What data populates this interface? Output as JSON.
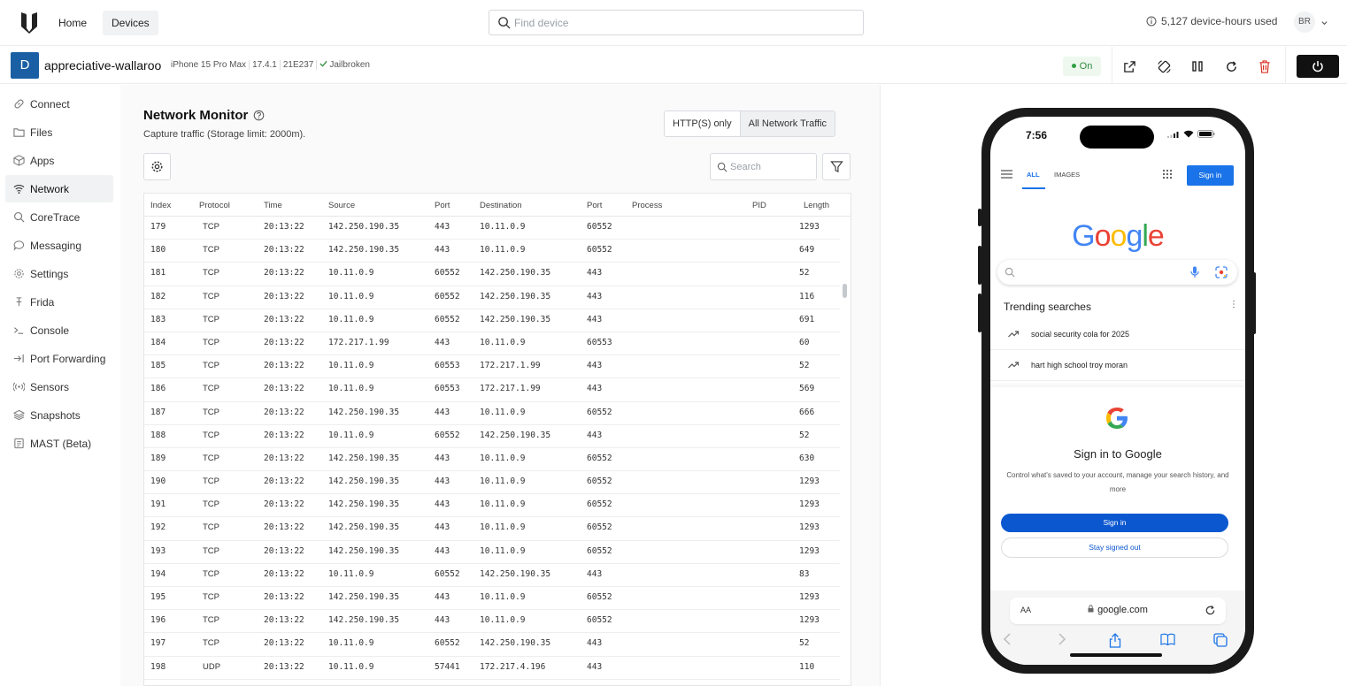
{
  "topbar": {
    "nav": [
      {
        "label": "Home"
      },
      {
        "label": "Devices"
      }
    ],
    "search_placeholder": "Find device",
    "hours_used": "5,127 device-hours used",
    "user_initials": "BR"
  },
  "device": {
    "avatar": "D",
    "name": "appreciative-wallaroo",
    "model": "iPhone 15 Pro Max",
    "os_version": "17.4.1",
    "build": "21E237",
    "jailbreak": "Jailbroken",
    "status": "On"
  },
  "sidebar": {
    "items": [
      {
        "label": "Connect",
        "icon": "link-icon"
      },
      {
        "label": "Files",
        "icon": "folder-icon"
      },
      {
        "label": "Apps",
        "icon": "cube-icon"
      },
      {
        "label": "Network",
        "icon": "wifi-icon"
      },
      {
        "label": "CoreTrace",
        "icon": "search-icon"
      },
      {
        "label": "Messaging",
        "icon": "chat-icon"
      },
      {
        "label": "Settings",
        "icon": "gear-icon"
      },
      {
        "label": "Frida",
        "icon": "frida-icon"
      },
      {
        "label": "Console",
        "icon": "terminal-icon"
      },
      {
        "label": "Port Forwarding",
        "icon": "port-forward-icon"
      },
      {
        "label": "Sensors",
        "icon": "sensors-icon"
      },
      {
        "label": "Snapshots",
        "icon": "layers-icon"
      },
      {
        "label": "MAST (Beta)",
        "icon": "report-icon"
      }
    ],
    "active": "Network"
  },
  "network": {
    "title": "Network Monitor",
    "subtitle": "Capture traffic (Storage limit: 2000m).",
    "mode_http": "HTTP(S) only",
    "mode_all": "All Network Traffic",
    "search_placeholder": "Search",
    "columns": [
      "Index",
      "Protocol",
      "Time",
      "Source",
      "Port",
      "Destination",
      "Port",
      "Process",
      "PID",
      "Length"
    ],
    "rows": [
      [
        "179",
        "TCP",
        "20:13:22",
        "142.250.190.35",
        "443",
        "10.11.0.9",
        "60552",
        "",
        "",
        "1293"
      ],
      [
        "180",
        "TCP",
        "20:13:22",
        "142.250.190.35",
        "443",
        "10.11.0.9",
        "60552",
        "",
        "",
        "649"
      ],
      [
        "181",
        "TCP",
        "20:13:22",
        "10.11.0.9",
        "60552",
        "142.250.190.35",
        "443",
        "",
        "",
        "52"
      ],
      [
        "182",
        "TCP",
        "20:13:22",
        "10.11.0.9",
        "60552",
        "142.250.190.35",
        "443",
        "",
        "",
        "116"
      ],
      [
        "183",
        "TCP",
        "20:13:22",
        "10.11.0.9",
        "60552",
        "142.250.190.35",
        "443",
        "",
        "",
        "691"
      ],
      [
        "184",
        "TCP",
        "20:13:22",
        "172.217.1.99",
        "443",
        "10.11.0.9",
        "60553",
        "",
        "",
        "60"
      ],
      [
        "185",
        "TCP",
        "20:13:22",
        "10.11.0.9",
        "60553",
        "172.217.1.99",
        "443",
        "",
        "",
        "52"
      ],
      [
        "186",
        "TCP",
        "20:13:22",
        "10.11.0.9",
        "60553",
        "172.217.1.99",
        "443",
        "",
        "",
        "569"
      ],
      [
        "187",
        "TCP",
        "20:13:22",
        "142.250.190.35",
        "443",
        "10.11.0.9",
        "60552",
        "",
        "",
        "666"
      ],
      [
        "188",
        "TCP",
        "20:13:22",
        "10.11.0.9",
        "60552",
        "142.250.190.35",
        "443",
        "",
        "",
        "52"
      ],
      [
        "189",
        "TCP",
        "20:13:22",
        "142.250.190.35",
        "443",
        "10.11.0.9",
        "60552",
        "",
        "",
        "630"
      ],
      [
        "190",
        "TCP",
        "20:13:22",
        "142.250.190.35",
        "443",
        "10.11.0.9",
        "60552",
        "",
        "",
        "1293"
      ],
      [
        "191",
        "TCP",
        "20:13:22",
        "142.250.190.35",
        "443",
        "10.11.0.9",
        "60552",
        "",
        "",
        "1293"
      ],
      [
        "192",
        "TCP",
        "20:13:22",
        "142.250.190.35",
        "443",
        "10.11.0.9",
        "60552",
        "",
        "",
        "1293"
      ],
      [
        "193",
        "TCP",
        "20:13:22",
        "142.250.190.35",
        "443",
        "10.11.0.9",
        "60552",
        "",
        "",
        "1293"
      ],
      [
        "194",
        "TCP",
        "20:13:22",
        "10.11.0.9",
        "60552",
        "142.250.190.35",
        "443",
        "",
        "",
        "83"
      ],
      [
        "195",
        "TCP",
        "20:13:22",
        "142.250.190.35",
        "443",
        "10.11.0.9",
        "60552",
        "",
        "",
        "1293"
      ],
      [
        "196",
        "TCP",
        "20:13:22",
        "142.250.190.35",
        "443",
        "10.11.0.9",
        "60552",
        "",
        "",
        "1293"
      ],
      [
        "197",
        "TCP",
        "20:13:22",
        "10.11.0.9",
        "60552",
        "142.250.190.35",
        "443",
        "",
        "",
        "52"
      ],
      [
        "198",
        "UDP",
        "20:13:22",
        "10.11.0.9",
        "57441",
        "172.217.4.196",
        "443",
        "",
        "",
        "110"
      ]
    ]
  },
  "phone": {
    "time": "7:56",
    "tab_all": "ALL",
    "tab_images": "IMAGES",
    "sign_in": "Sign in",
    "logo_text": "Google",
    "trending_title": "Trending searches",
    "trending": [
      "social security cola for 2025",
      "hart high school troy moran"
    ],
    "sheet_title": "Sign in to Google",
    "sheet_desc": "Control what's saved to your account, manage your search history, and more",
    "sheet_signin": "Sign in",
    "sheet_stay": "Stay signed out",
    "aa": "AA",
    "url": "google.com"
  },
  "colors": {
    "accent": "#1a5fa3",
    "google_blue": "#1a73e8",
    "status_green": "#2ea043",
    "danger": "#d93025"
  }
}
